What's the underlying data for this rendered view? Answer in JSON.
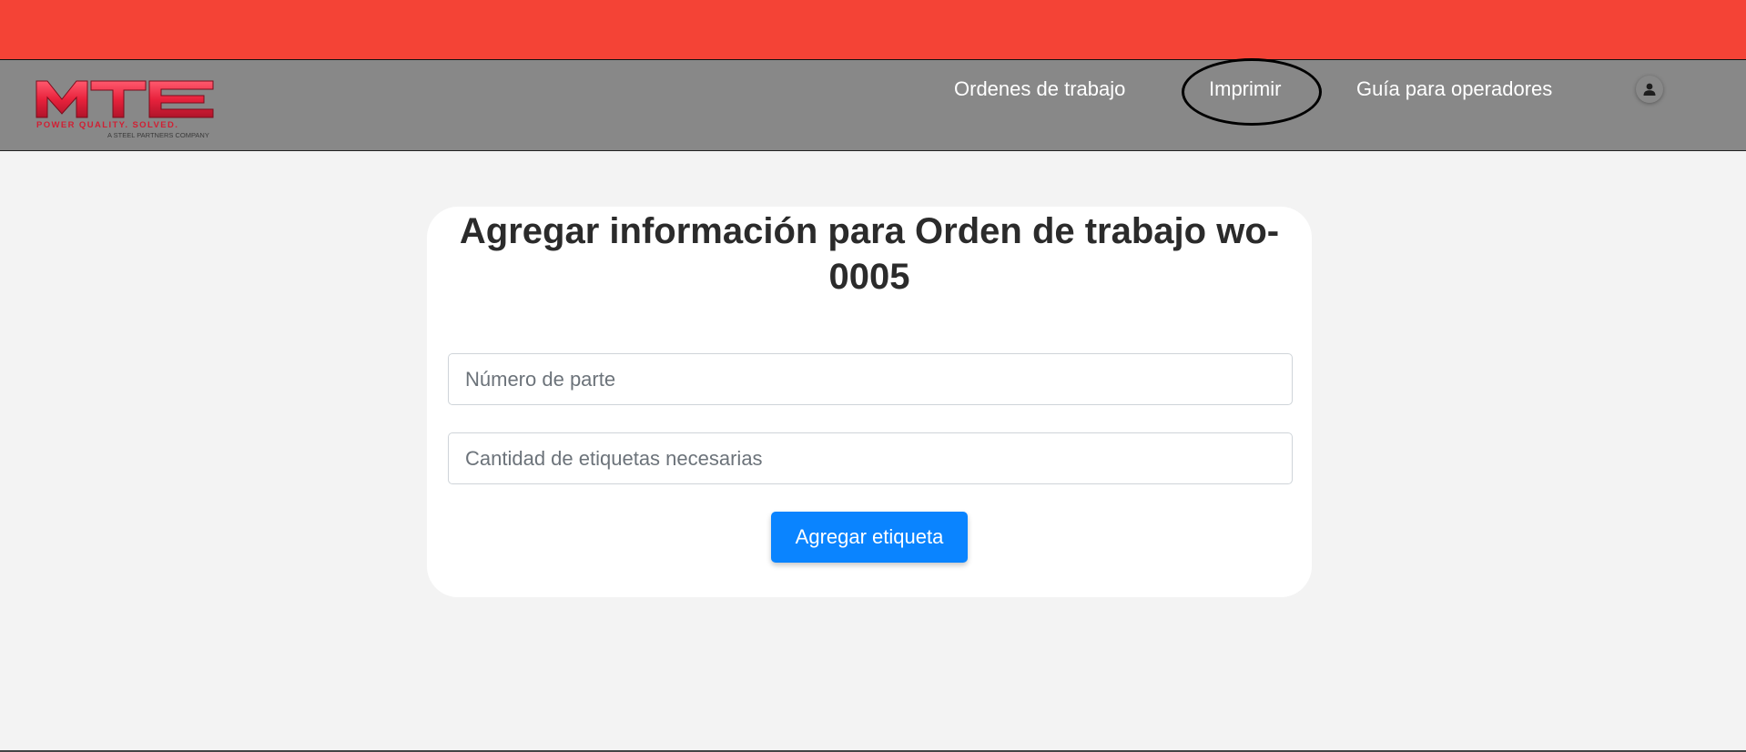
{
  "branding": {
    "logo_text": "MTE",
    "logo_tagline": "POWER QUALITY. SOLVED.",
    "logo_subtagline": "A STEEL PARTNERS COMPANY",
    "primary_color": "#f44336",
    "navbar_color": "#888888"
  },
  "nav": {
    "items": [
      {
        "label": "Ordenes de trabajo"
      },
      {
        "label": "Imprimir"
      },
      {
        "label": "Guía para operadores"
      }
    ],
    "user_icon": "user-icon"
  },
  "form": {
    "title": "Agregar información para Orden de trabajo wo-0005",
    "part_number_placeholder": "Número de parte",
    "part_number_value": "",
    "label_qty_placeholder": "Cantidad de etiquetas necesarias",
    "label_qty_value": "",
    "submit_label": "Agregar etiqueta",
    "button_color": "#0a84ff"
  }
}
